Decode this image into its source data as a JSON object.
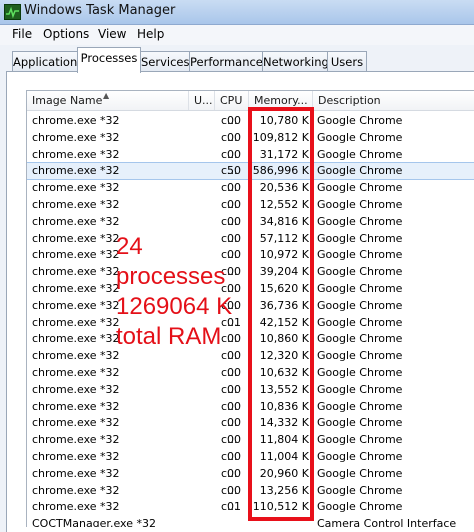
{
  "window": {
    "title": "Windows Task Manager"
  },
  "menu": [
    "File",
    "Options",
    "View",
    "Help"
  ],
  "tabs": [
    "Applications",
    "Processes",
    "Services",
    "Performance",
    "Networking",
    "Users"
  ],
  "active_tab": "Processes",
  "columns": {
    "image_name": "Image Name",
    "user": "U...",
    "cpu": "CPU",
    "memory": "Memory...",
    "description": "Description"
  },
  "rows": [
    {
      "name": "chrome.exe *32",
      "user": "c...",
      "cpu": "00",
      "memory": "10,780 K",
      "description": "Google Chrome"
    },
    {
      "name": "chrome.exe *32",
      "user": "c...",
      "cpu": "00",
      "memory": "109,812 K",
      "description": "Google Chrome"
    },
    {
      "name": "chrome.exe *32",
      "user": "c...",
      "cpu": "00",
      "memory": "31,172 K",
      "description": "Google Chrome"
    },
    {
      "name": "chrome.exe *32",
      "user": "c...",
      "cpu": "50",
      "memory": "586,996 K",
      "description": "Google Chrome"
    },
    {
      "name": "chrome.exe *32",
      "user": "c...",
      "cpu": "00",
      "memory": "20,536 K",
      "description": "Google Chrome"
    },
    {
      "name": "chrome.exe *32",
      "user": "c...",
      "cpu": "00",
      "memory": "12,552 K",
      "description": "Google Chrome"
    },
    {
      "name": "chrome.exe *32",
      "user": "c...",
      "cpu": "00",
      "memory": "34,816 K",
      "description": "Google Chrome"
    },
    {
      "name": "chrome.exe *32",
      "user": "c...",
      "cpu": "00",
      "memory": "57,112 K",
      "description": "Google Chrome"
    },
    {
      "name": "chrome.exe *32",
      "user": "c...",
      "cpu": "00",
      "memory": "10,972 K",
      "description": "Google Chrome"
    },
    {
      "name": "chrome.exe *32",
      "user": "c...",
      "cpu": "00",
      "memory": "39,204 K",
      "description": "Google Chrome"
    },
    {
      "name": "chrome.exe *32",
      "user": "c...",
      "cpu": "00",
      "memory": "15,620 K",
      "description": "Google Chrome"
    },
    {
      "name": "chrome.exe *32",
      "user": "c...",
      "cpu": "00",
      "memory": "36,736 K",
      "description": "Google Chrome"
    },
    {
      "name": "chrome.exe *32",
      "user": "c...",
      "cpu": "01",
      "memory": "42,152 K",
      "description": "Google Chrome"
    },
    {
      "name": "chrome.exe *32",
      "user": "c...",
      "cpu": "00",
      "memory": "10,860 K",
      "description": "Google Chrome"
    },
    {
      "name": "chrome.exe *32",
      "user": "c...",
      "cpu": "00",
      "memory": "12,320 K",
      "description": "Google Chrome"
    },
    {
      "name": "chrome.exe *32",
      "user": "c...",
      "cpu": "00",
      "memory": "10,632 K",
      "description": "Google Chrome"
    },
    {
      "name": "chrome.exe *32",
      "user": "c...",
      "cpu": "00",
      "memory": "13,552 K",
      "description": "Google Chrome"
    },
    {
      "name": "chrome.exe *32",
      "user": "c...",
      "cpu": "00",
      "memory": "10,836 K",
      "description": "Google Chrome"
    },
    {
      "name": "chrome.exe *32",
      "user": "c...",
      "cpu": "00",
      "memory": "14,332 K",
      "description": "Google Chrome"
    },
    {
      "name": "chrome.exe *32",
      "user": "c...",
      "cpu": "00",
      "memory": "11,804 K",
      "description": "Google Chrome"
    },
    {
      "name": "chrome.exe *32",
      "user": "c...",
      "cpu": "00",
      "memory": "11,004 K",
      "description": "Google Chrome"
    },
    {
      "name": "chrome.exe *32",
      "user": "c...",
      "cpu": "00",
      "memory": "20,960 K",
      "description": "Google Chrome"
    },
    {
      "name": "chrome.exe *32",
      "user": "c...",
      "cpu": "00",
      "memory": "13,256 K",
      "description": "Google Chrome"
    },
    {
      "name": "chrome.exe *32",
      "user": "c...",
      "cpu": "01",
      "memory": "110,512 K",
      "description": "Google Chrome"
    },
    {
      "name": "COCTManager.exe *32",
      "user": "",
      "cpu": "",
      "memory": "",
      "description": "Camera Control Interface"
    }
  ],
  "selected_row": 3,
  "annotation": {
    "line1": "24",
    "line2": "processes",
    "line3": "1269064 K",
    "line4": "total RAM"
  },
  "colors": {
    "annotation": "#e41018",
    "selection": "#e6f0fb",
    "titlebar": "#b7d0ee"
  }
}
